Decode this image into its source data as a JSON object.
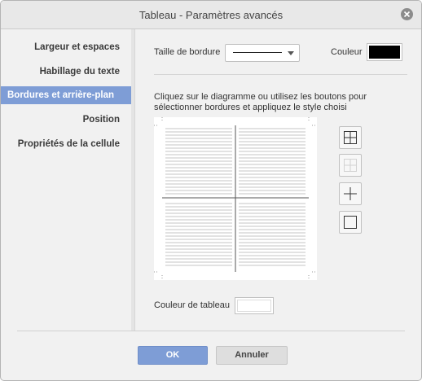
{
  "window": {
    "title": "Tableau - Paramètres avancés"
  },
  "sidebar": {
    "items": [
      {
        "label": "Largeur et espaces",
        "active": false
      },
      {
        "label": "Habillage du texte",
        "active": false
      },
      {
        "label": "Bordures et arrière-plan",
        "active": true
      },
      {
        "label": "Position",
        "active": false
      },
      {
        "label": "Propriétés de la cellule",
        "active": false
      }
    ]
  },
  "border": {
    "size_label": "Taille de bordure",
    "color_label": "Couleur",
    "color_value": "#000000",
    "instructions": "Cliquez sur le diagramme ou utilisez les boutons pour sélectionner bordures et appliquez le style choisi"
  },
  "preset_buttons": [
    {
      "icon": "all-borders-icon",
      "enabled": true
    },
    {
      "icon": "no-borders-icon",
      "enabled": false
    },
    {
      "icon": "inner-borders-icon",
      "enabled": true
    },
    {
      "icon": "outer-border-icon",
      "enabled": true
    }
  ],
  "table_color": {
    "label": "Couleur de tableau",
    "value": "#ffffff"
  },
  "buttons": {
    "ok": "OK",
    "cancel": "Annuler"
  },
  "colors": {
    "accent": "#7e9dd6",
    "panel": "#f1f1f1"
  }
}
